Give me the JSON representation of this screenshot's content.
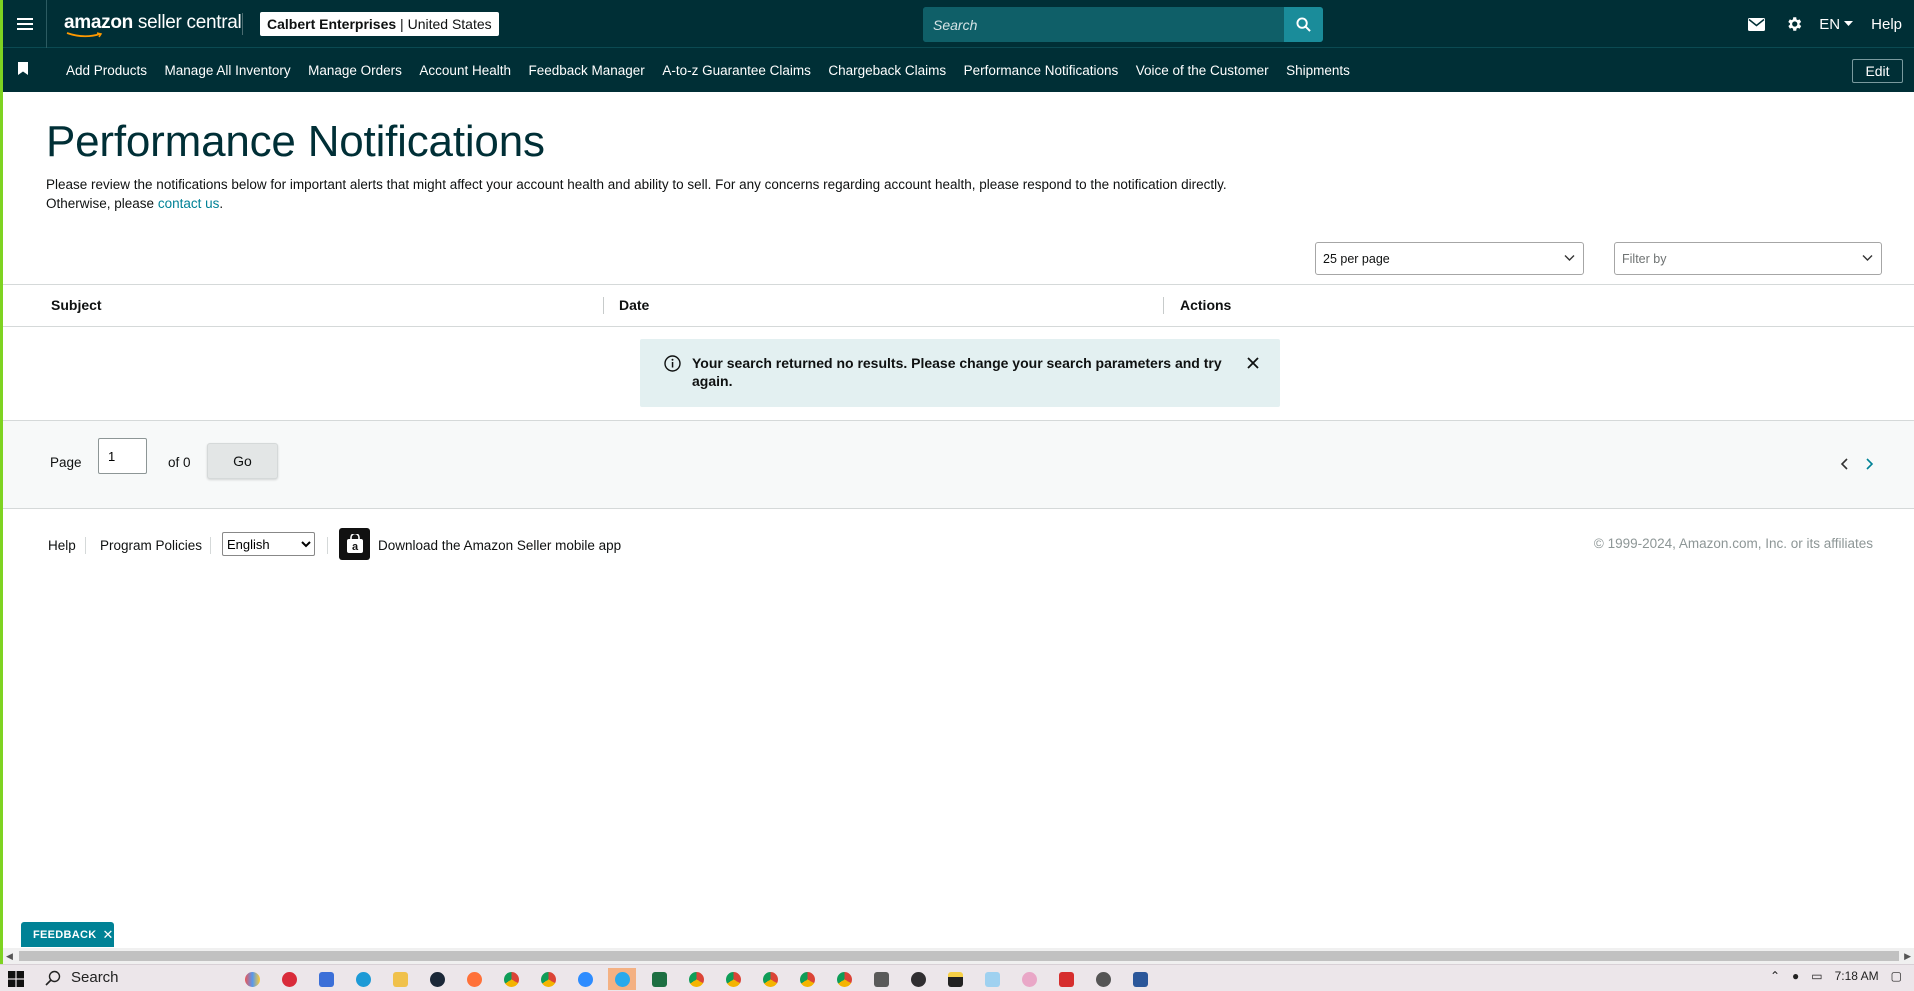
{
  "topbar": {
    "logo_text_bold": "amazon",
    "logo_text_rest": " seller central",
    "account_name": "Calbert Enterprises",
    "account_region": " | United States",
    "search_placeholder": "Search",
    "language": "EN",
    "help_label": "Help"
  },
  "nav": {
    "items": [
      "Add Products",
      "Manage All Inventory",
      "Manage Orders",
      "Account Health",
      "Feedback Manager",
      "A-to-z Guarantee Claims",
      "Chargeback Claims",
      "Performance Notifications",
      "Voice of the Customer",
      "Shipments"
    ],
    "edit_label": "Edit"
  },
  "page": {
    "title": "Performance Notifications",
    "intro": "Please review the notifications below for important alerts that might affect your account health and ability to sell. For any concerns regarding account health, please respond to the notification directly. Otherwise, please ",
    "intro_link": "contact us",
    "intro_end": "."
  },
  "controls": {
    "per_page": "25 per page",
    "filter_placeholder": "Filter by"
  },
  "table": {
    "columns": [
      "Subject",
      "Date",
      "Actions"
    ]
  },
  "alert": {
    "message": "Your search returned no results. Please change your search parameters and try again."
  },
  "pagination": {
    "page_label": "Page",
    "current_page": "1",
    "of_label": "of 0",
    "go_label": "Go"
  },
  "footer": {
    "help": "Help",
    "program_policies": "Program Policies",
    "language": "English",
    "app_download": "Download the Amazon Seller mobile app",
    "copyright": "© 1999-2024, Amazon.com, Inc. or its affiliates"
  },
  "feedback": {
    "label": "FEEDBACK"
  },
  "taskbar": {
    "search_label": "Search",
    "time": "7:18 AM"
  },
  "colors": {
    "header_bg": "#002f36",
    "accent": "#008296",
    "alert_bg": "#e3f0f1"
  }
}
